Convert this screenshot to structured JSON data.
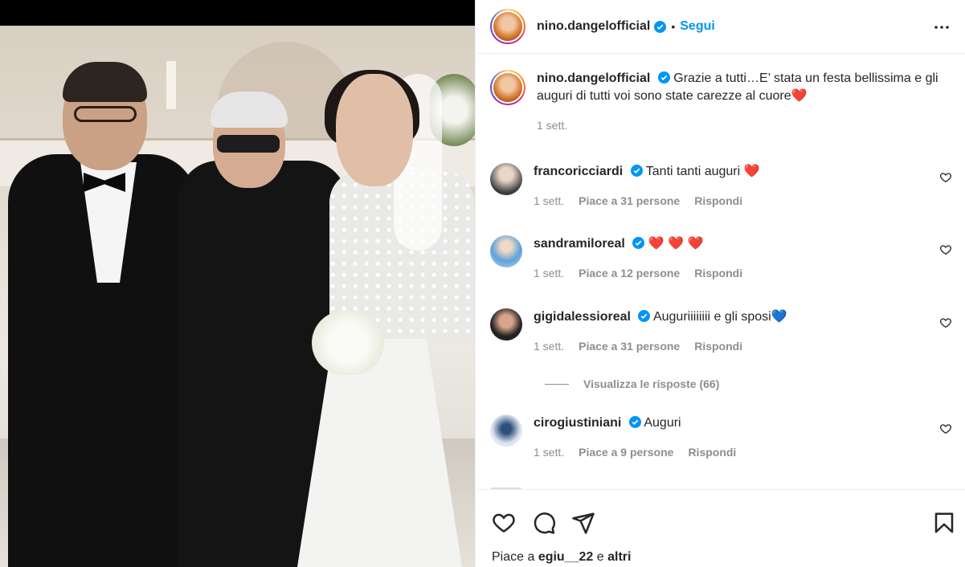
{
  "post": {
    "username": "nino.dangelofficial",
    "follow_label": "Segui",
    "separator": "•"
  },
  "caption": {
    "username": "nino.dangelofficial",
    "text": "Grazie a tutti…E’ stata un festa bellissima e gli auguri di tutti voi sono state carezze al cuore",
    "emoji": "❤️",
    "time": "1 sett."
  },
  "comments": [
    {
      "username": "francoricciardi",
      "text": "Tanti tanti auguri ",
      "emoji": "❤️",
      "time": "1 sett.",
      "likes": "Piace a 31 persone",
      "reply": "Rispondi"
    },
    {
      "username": "sandramiloreal",
      "text": "",
      "emoji": "❤️ ❤️ ❤️",
      "time": "1 sett.",
      "likes": "Piace a 12 persone",
      "reply": "Rispondi"
    },
    {
      "username": "gigidalessioreal",
      "text": "Auguriiiiiiii e gli sposi",
      "emoji": "💙",
      "time": "1 sett.",
      "likes": "Piace a 31 persone",
      "reply": "Rispondi"
    },
    {
      "username": "cirogiustiniani",
      "text": "Auguri",
      "emoji": "",
      "time": "1 sett.",
      "likes": "Piace a 9 persone",
      "reply": "Rispondi"
    }
  ],
  "view_replies": "Visualizza le risposte (66)",
  "likes_line": {
    "prefix": "Piace a ",
    "user": "egiu__22",
    "middle": " e ",
    "rest": "altri"
  },
  "icons": {
    "more": "more-horizontal-icon",
    "like": "heart-outline-icon",
    "comment": "comment-bubble-icon",
    "share": "paper-plane-icon",
    "save": "bookmark-icon",
    "verified": "verified-badge-icon"
  },
  "colors": {
    "follow": "#0095f6",
    "verified": "#0095f6",
    "muted": "#8e8e8e",
    "heart": "#ed1a3b"
  }
}
